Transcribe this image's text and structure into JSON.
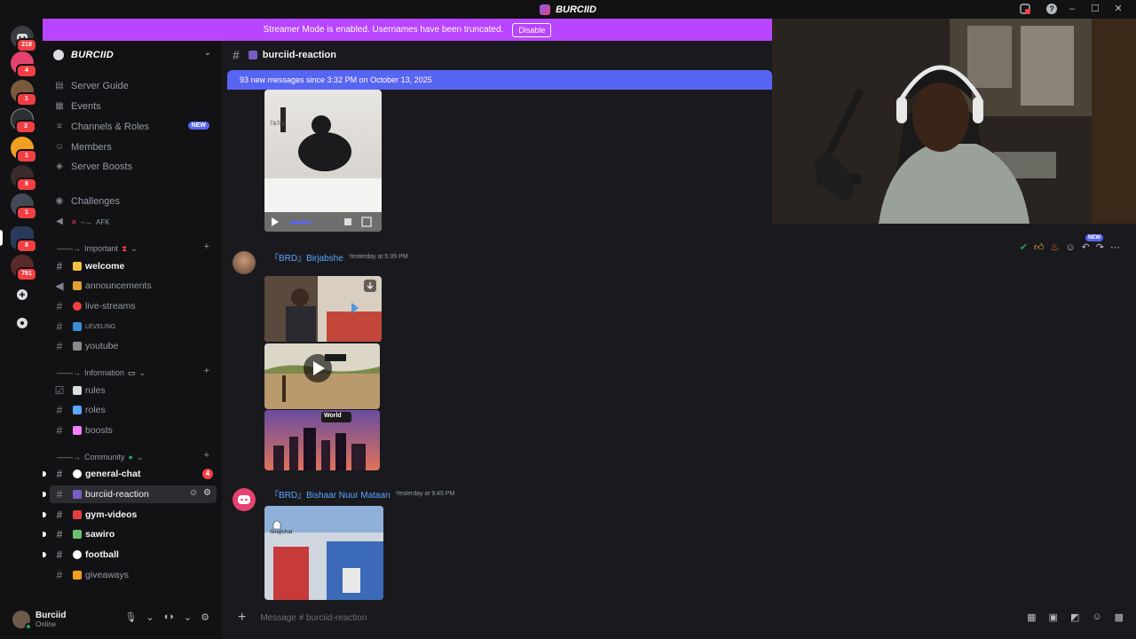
{
  "window": {
    "title": "BURCIID",
    "controls": [
      "–",
      "☐",
      "✕"
    ]
  },
  "rail": {
    "servers": [
      {
        "badge": "218",
        "color": "#3a3c42"
      },
      {
        "badge": "4",
        "color": "#e4436f"
      },
      {
        "badge": "1",
        "color": "#7a5a3c"
      },
      {
        "badge": "3",
        "color": "#2c2f33"
      },
      {
        "badge": "1",
        "color": "#f0a020"
      },
      {
        "badge": "8",
        "color": "#3b2b2b"
      },
      {
        "badge": "1",
        "color": "#444a55"
      },
      {
        "badge": "8",
        "color": "#2a3a5a"
      },
      {
        "badge": "781",
        "color": "#5a2a2a"
      }
    ]
  },
  "sidebar": {
    "server_name": "BURCIID",
    "items": [
      {
        "label": "Server Guide",
        "icon": "guide-icon"
      },
      {
        "label": "Events",
        "icon": "calendar-icon"
      },
      {
        "label": "Channels & Roles",
        "icon": "channels-icon",
        "tag": "NEW"
      },
      {
        "label": "Members",
        "icon": "members-icon"
      },
      {
        "label": "Server Boosts",
        "icon": "boost-icon"
      }
    ],
    "challenges": "Challenges",
    "afk": "AFK",
    "categories": {
      "important": "Important",
      "information": "Information",
      "community": "Community"
    },
    "channels": {
      "welcome": "welcome",
      "announcements": "announcements",
      "live_streams": "live-streams",
      "leveling": "LEVELING",
      "youtube": "youtube",
      "rules": "rules",
      "roles": "roles",
      "boosts": "boosts",
      "general_chat": "general-chat",
      "burciid_reaction": "burciid-reaction",
      "gym_videos": "gym-videos",
      "sawiro": "sawiro",
      "football": "football",
      "giveaways": "giveaways"
    },
    "general_chat_count": "4"
  },
  "user": {
    "name": "Burciid",
    "status": "Online"
  },
  "banner": {
    "text": "Streamer Mode is enabled. Usernames have been truncated.",
    "button": "Disable"
  },
  "channel_header": {
    "name": "burciid-reaction"
  },
  "new_messages": "93 new messages since 3:32 PM on October 13, 2025",
  "messages": [
    {
      "author": "『BRD』Birjabshe",
      "timestamp": "Yesterday at 5:39 PM"
    },
    {
      "author": "『BRD』Bishaar Nuur Mataan",
      "timestamp": "Yesterday at 9:45 PM"
    }
  ],
  "media_labels": {
    "world": "World",
    "snapchat": "Snapchat",
    "tiktok": "TikTok"
  },
  "reaction_new": "NEW",
  "composer": {
    "placeholder": "Message #  burciid-reaction"
  }
}
